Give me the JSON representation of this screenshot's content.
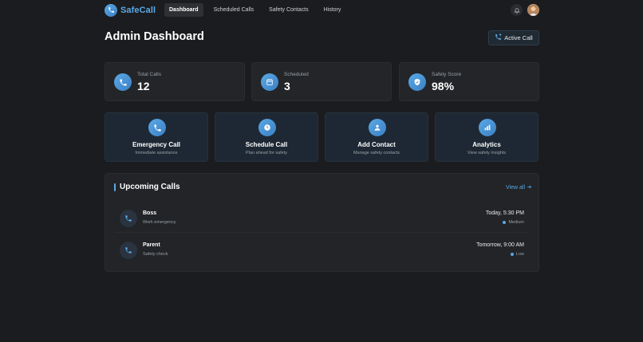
{
  "brand": {
    "name": "SafeCall"
  },
  "nav": {
    "items": [
      {
        "label": "Dashboard",
        "active": true
      },
      {
        "label": "Scheduled Calls",
        "active": false
      },
      {
        "label": "Safety Contacts",
        "active": false
      },
      {
        "label": "History",
        "active": false
      }
    ],
    "icons": [
      "bell-icon",
      "user-avatar"
    ]
  },
  "header": {
    "title": "Admin Dashboard",
    "active_call_label": "Active Call"
  },
  "stats": [
    {
      "label": "Total Calls",
      "value": "12",
      "icon": "phone-icon"
    },
    {
      "label": "Scheduled",
      "value": "3",
      "icon": "calendar-icon"
    },
    {
      "label": "Safety Score",
      "value": "98%",
      "icon": "shield-icon"
    }
  ],
  "actions": [
    {
      "title": "Emergency Call",
      "subtitle": "Immediate assistance",
      "icon": "phone-icon"
    },
    {
      "title": "Schedule Call",
      "subtitle": "Plan ahead for safety",
      "icon": "clock-icon"
    },
    {
      "title": "Add Contact",
      "subtitle": "Manage safety contacts",
      "icon": "user-icon"
    },
    {
      "title": "Analytics",
      "subtitle": "View safety insights",
      "icon": "chart-icon"
    }
  ],
  "upcoming": {
    "title": "Upcoming Calls",
    "view_all": "View all",
    "calls": [
      {
        "name": "Boss",
        "note": "Work emergency",
        "time": "Today, 5:30 PM",
        "priority": "Medium"
      },
      {
        "name": "Parent",
        "note": "Safety check",
        "time": "Tomorrow, 9:00 AM",
        "priority": "Low"
      }
    ]
  },
  "colors": {
    "accent": "#5aa9e6",
    "background": "#1b1c1f",
    "card": "#232528",
    "action_card": "#1e2834"
  }
}
